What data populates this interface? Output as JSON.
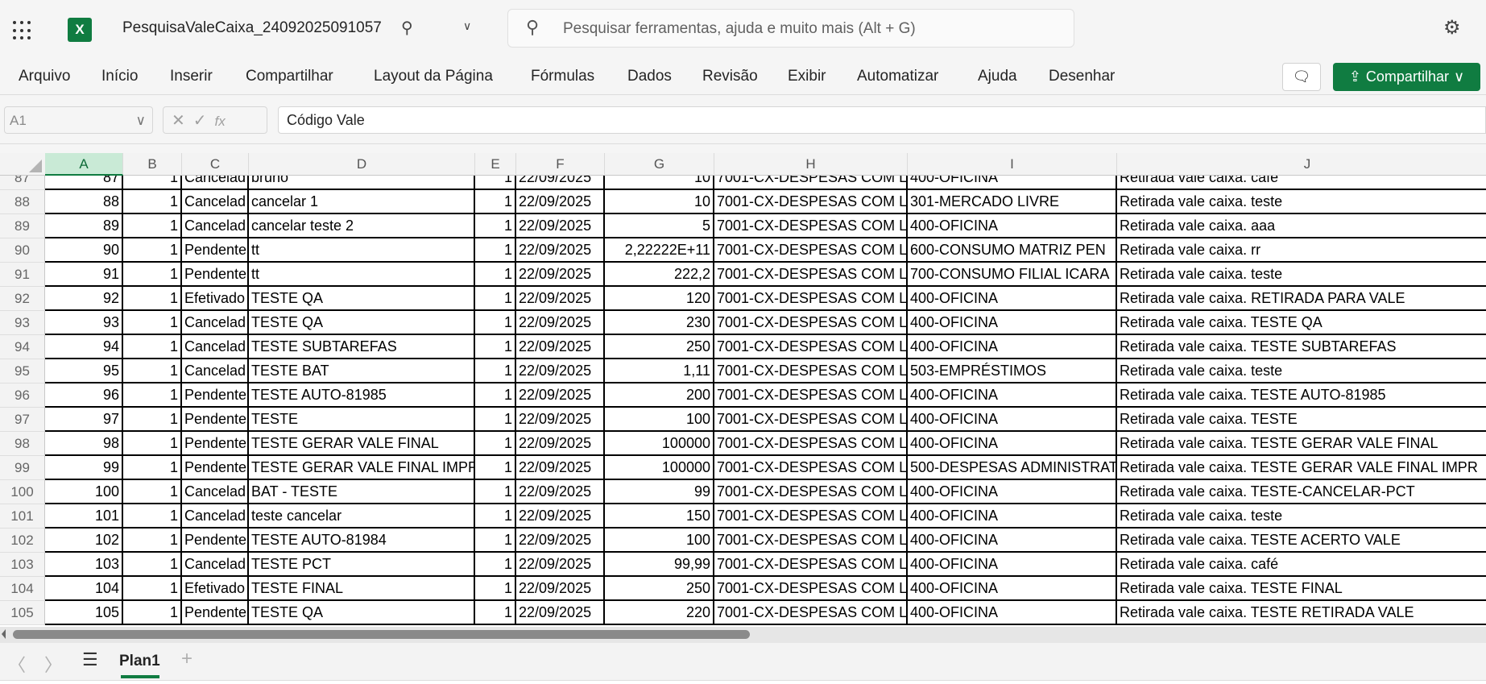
{
  "app": {
    "title": "PesquisaValeCaixa_24092025091057",
    "brand_color": "#107c41"
  },
  "search": {
    "placeholder": "Pesquisar ferramentas, ajuda e muito mais (Alt + G)"
  },
  "ribbon": {
    "tabs": [
      "Arquivo",
      "Início",
      "Inserir",
      "Compartilhar",
      "Layout da Página",
      "Fórmulas",
      "Dados",
      "Revisão",
      "Exibir",
      "Automatizar",
      "Ajuda",
      "Desenhar"
    ],
    "share_label": "Compartilhar"
  },
  "formula_bar": {
    "cell_ref": "A1",
    "fx_label": "fx",
    "value": "Código Vale"
  },
  "columns": [
    "A",
    "B",
    "C",
    "D",
    "E",
    "F",
    "G",
    "H",
    "I",
    "J"
  ],
  "selected_column": "A",
  "rows": [
    {
      "n": "87",
      "cells": [
        "87",
        "1",
        "Cancelad",
        "bruno",
        "1",
        "22/09/2025",
        "10",
        "7001-CX-DESPESAS COM L",
        "400-OFICINA",
        "Retirada vale caixa. café"
      ]
    },
    {
      "n": "88",
      "cells": [
        "88",
        "1",
        "Cancelad",
        "cancelar 1",
        "1",
        "22/09/2025",
        "10",
        "7001-CX-DESPESAS COM L",
        "301-MERCADO LIVRE",
        "Retirada vale caixa. teste"
      ]
    },
    {
      "n": "89",
      "cells": [
        "89",
        "1",
        "Cancelad",
        "cancelar teste 2",
        "1",
        "22/09/2025",
        "5",
        "7001-CX-DESPESAS COM L",
        "400-OFICINA",
        "Retirada vale caixa. aaa"
      ]
    },
    {
      "n": "90",
      "cells": [
        "90",
        "1",
        "Pendente",
        "tt",
        "1",
        "22/09/2025",
        "2,22222E+11",
        "7001-CX-DESPESAS COM L",
        "600-CONSUMO MATRIZ PEN",
        "Retirada vale caixa. rr"
      ]
    },
    {
      "n": "91",
      "cells": [
        "91",
        "1",
        "Pendente",
        "tt",
        "1",
        "22/09/2025",
        "222,2",
        "7001-CX-DESPESAS COM L",
        "700-CONSUMO FILIAL ICARA",
        "Retirada vale caixa. teste"
      ]
    },
    {
      "n": "92",
      "cells": [
        "92",
        "1",
        "Efetivado",
        "TESTE QA",
        "1",
        "22/09/2025",
        "120",
        "7001-CX-DESPESAS COM L",
        "400-OFICINA",
        "Retirada vale caixa. RETIRADA PARA VALE"
      ]
    },
    {
      "n": "93",
      "cells": [
        "93",
        "1",
        "Cancelad",
        "TESTE QA",
        "1",
        "22/09/2025",
        "230",
        "7001-CX-DESPESAS COM L",
        "400-OFICINA",
        "Retirada vale caixa. TESTE QA"
      ]
    },
    {
      "n": "94",
      "cells": [
        "94",
        "1",
        "Cancelad",
        "TESTE SUBTAREFAS",
        "1",
        "22/09/2025",
        "250",
        "7001-CX-DESPESAS COM L",
        "400-OFICINA",
        "Retirada vale caixa. TESTE SUBTAREFAS"
      ]
    },
    {
      "n": "95",
      "cells": [
        "95",
        "1",
        "Cancelad",
        "TESTE BAT",
        "1",
        "22/09/2025",
        "1,11",
        "7001-CX-DESPESAS COM L",
        "503-EMPRÉSTIMOS",
        "Retirada vale caixa. teste"
      ]
    },
    {
      "n": "96",
      "cells": [
        "96",
        "1",
        "Pendente",
        "TESTE AUTO-81985",
        "1",
        "22/09/2025",
        "200",
        "7001-CX-DESPESAS COM L",
        "400-OFICINA",
        "Retirada vale caixa. TESTE AUTO-81985"
      ]
    },
    {
      "n": "97",
      "cells": [
        "97",
        "1",
        "Pendente",
        "TESTE",
        "1",
        "22/09/2025",
        "100",
        "7001-CX-DESPESAS COM L",
        "400-OFICINA",
        "Retirada vale caixa. TESTE"
      ]
    },
    {
      "n": "98",
      "cells": [
        "98",
        "1",
        "Pendente",
        "TESTE GERAR VALE FINAL",
        "1",
        "22/09/2025",
        "100000",
        "7001-CX-DESPESAS COM L",
        "400-OFICINA",
        "Retirada vale caixa. TESTE GERAR VALE FINAL"
      ]
    },
    {
      "n": "99",
      "cells": [
        "99",
        "1",
        "Pendente",
        "TESTE GERAR VALE FINAL IMPR",
        "1",
        "22/09/2025",
        "100000",
        "7001-CX-DESPESAS COM L",
        "500-DESPESAS ADMINISTRAT",
        "Retirada vale caixa. TESTE GERAR VALE FINAL IMPR"
      ]
    },
    {
      "n": "100",
      "cells": [
        "100",
        "1",
        "Cancelad",
        "BAT - TESTE",
        "1",
        "22/09/2025",
        "99",
        "7001-CX-DESPESAS COM L",
        "400-OFICINA",
        "Retirada vale caixa. TESTE-CANCELAR-PCT"
      ]
    },
    {
      "n": "101",
      "cells": [
        "101",
        "1",
        "Cancelad",
        "teste cancelar",
        "1",
        "22/09/2025",
        "150",
        "7001-CX-DESPESAS COM L",
        "400-OFICINA",
        "Retirada vale caixa. teste"
      ]
    },
    {
      "n": "102",
      "cells": [
        "102",
        "1",
        "Pendente",
        "TESTE AUTO-81984",
        "1",
        "22/09/2025",
        "100",
        "7001-CX-DESPESAS COM L",
        "400-OFICINA",
        "Retirada vale caixa. TESTE ACERTO VALE"
      ]
    },
    {
      "n": "103",
      "cells": [
        "103",
        "1",
        "Cancelad",
        "TESTE PCT",
        "1",
        "22/09/2025",
        "99,99",
        "7001-CX-DESPESAS COM L",
        "400-OFICINA",
        "Retirada vale caixa. café"
      ]
    },
    {
      "n": "104",
      "cells": [
        "104",
        "1",
        "Efetivado",
        "TESTE FINAL",
        "1",
        "22/09/2025",
        "250",
        "7001-CX-DESPESAS COM L",
        "400-OFICINA",
        "Retirada vale caixa. TESTE FINAL"
      ]
    },
    {
      "n": "105",
      "cells": [
        "105",
        "1",
        "Pendente",
        "TESTE QA",
        "1",
        "22/09/2025",
        "220",
        "7001-CX-DESPESAS COM L",
        "400-OFICINA",
        "Retirada vale caixa. TESTE RETIRADA VALE"
      ]
    }
  ],
  "sheets": [
    {
      "label": "Plan1",
      "active": true
    }
  ]
}
